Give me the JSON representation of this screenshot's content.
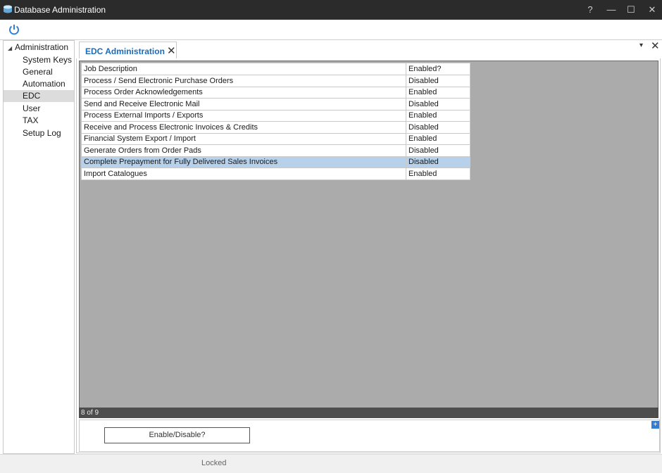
{
  "window": {
    "title": "Database Administration",
    "help": "?",
    "minimize": "—",
    "maximize": "☐",
    "close": "✕"
  },
  "sidebar": {
    "root": "Administration",
    "items": [
      "System Keys",
      "General",
      "Automation",
      "EDC",
      "User",
      "TAX",
      "Setup Log"
    ],
    "selected": "EDC"
  },
  "tab": {
    "label": "EDC Administration",
    "close": "✕"
  },
  "tabstrip": {
    "menu": "▾",
    "close": "✕"
  },
  "table": {
    "headers": [
      "Job Description",
      "Enabled?"
    ],
    "rows": [
      [
        "Process / Send Electronic Purchase Orders",
        "Disabled"
      ],
      [
        "Process Order Acknowledgements",
        "Enabled"
      ],
      [
        "Send and Receive Electronic Mail",
        "Disabled"
      ],
      [
        "Process External Imports / Exports",
        "Enabled"
      ],
      [
        "Receive and Process Electronic Invoices & Credits",
        "Disabled"
      ],
      [
        "Financial System Export / Import",
        "Enabled"
      ],
      [
        "Generate Orders from Order Pads",
        "Disabled"
      ],
      [
        "Complete Prepayment for Fully Delivered Sales Invoices",
        "Disabled"
      ],
      [
        "Import Catalogues",
        "Enabled"
      ]
    ],
    "selected_row": 7
  },
  "status": {
    "record_position": "8 of 9"
  },
  "actions": {
    "toggle_label": "Enable/Disable?",
    "add": "+"
  },
  "footer": {
    "status": "Locked"
  },
  "colors": {
    "accent": "#1e6bb8",
    "selection": "#b8d1ea",
    "grid_bg": "#ababab"
  }
}
